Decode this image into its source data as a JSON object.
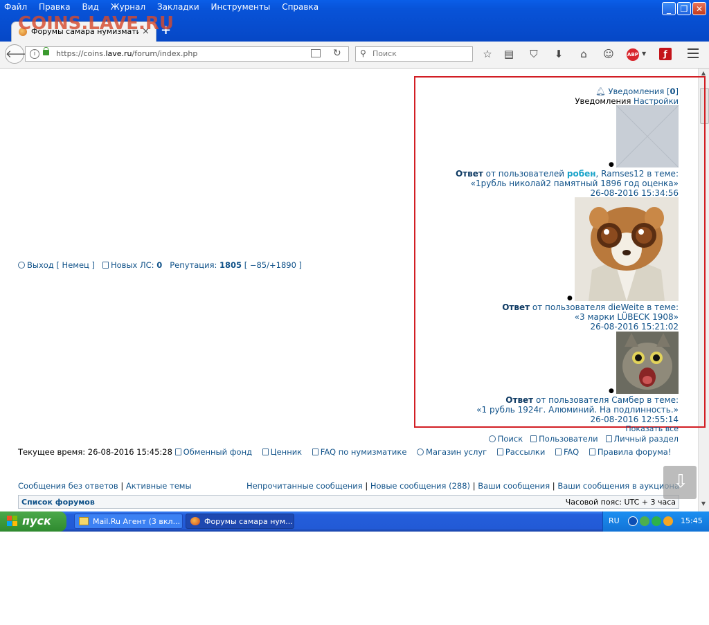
{
  "window": {
    "menu": [
      "Файл",
      "Правка",
      "Вид",
      "Журнал",
      "Закладки",
      "Инструменты",
      "Справка"
    ],
    "tab_title": "Форумы самара нумизматик...",
    "watermark": "COINS.LAVE.RU",
    "url_prefix": "https://coins.",
    "url_domain": "lave.ru",
    "url_suffix": "/forum/index.php",
    "search_placeholder": "Поиск",
    "abp_label": "ABP"
  },
  "userbar": {
    "logout": "Выход [ Немец ]",
    "new_pm_label": "Новых ЛС:",
    "new_pm_count": "0",
    "rep_label": "Репутация:",
    "rep_value": "1805",
    "rep_detail": "[ −85/+1890 ]"
  },
  "notifications": {
    "header_label": "Уведомления [",
    "header_count": "0",
    "header_close": "]",
    "sub_label": "Уведомления",
    "settings": "Настройки",
    "items": [
      {
        "kind": "Ответ",
        "from": " от пользователей ",
        "user1": "робен",
        "user2": ", Ramses12 в теме:",
        "topic": "«1рубль николай2 памятный 1896 год оценка»",
        "time": "26-08-2016 15:34:56"
      },
      {
        "kind": "Ответ",
        "from": " от пользователя dieWeite в теме:",
        "topic": "«3 марки LÜBECK 1908»",
        "time": "26-08-2016 15:21:02"
      },
      {
        "kind": "Ответ",
        "from": " от пользователя Самбер в теме:",
        "topic": "«1 рубль 1924г. Алюминий. На подлинность.»",
        "time": "26-08-2016 12:55:14"
      }
    ],
    "show_all": "Показать все"
  },
  "quick_links": {
    "search": "Поиск",
    "users": "Пользователи",
    "personal": "Личный раздел"
  },
  "footer": {
    "current_time": "Текущее время: 26-08-2016 15:45:28",
    "links": [
      "Обменный фонд",
      "Ценник",
      "FAQ по нумизматике",
      "Магазин услуг",
      "Рассылки",
      "FAQ",
      "Правила форума!"
    ]
  },
  "nav": {
    "left": [
      "Сообщения без ответов",
      "Активные темы"
    ],
    "right": [
      "Непрочитанные сообщения",
      "Новые сообщения (288)",
      "Ваши сообщения",
      "Ваши сообщения в аукциона"
    ]
  },
  "forum_bar": {
    "list": "Список форумов",
    "timezone": "Часовой пояс: UTC + 3 часа"
  },
  "taskbar": {
    "start": "пуск",
    "task1": "Mail.Ru Агент (3 вкл...",
    "task2": "Форумы самара нум...",
    "lang": "RU",
    "time": "15:45"
  }
}
